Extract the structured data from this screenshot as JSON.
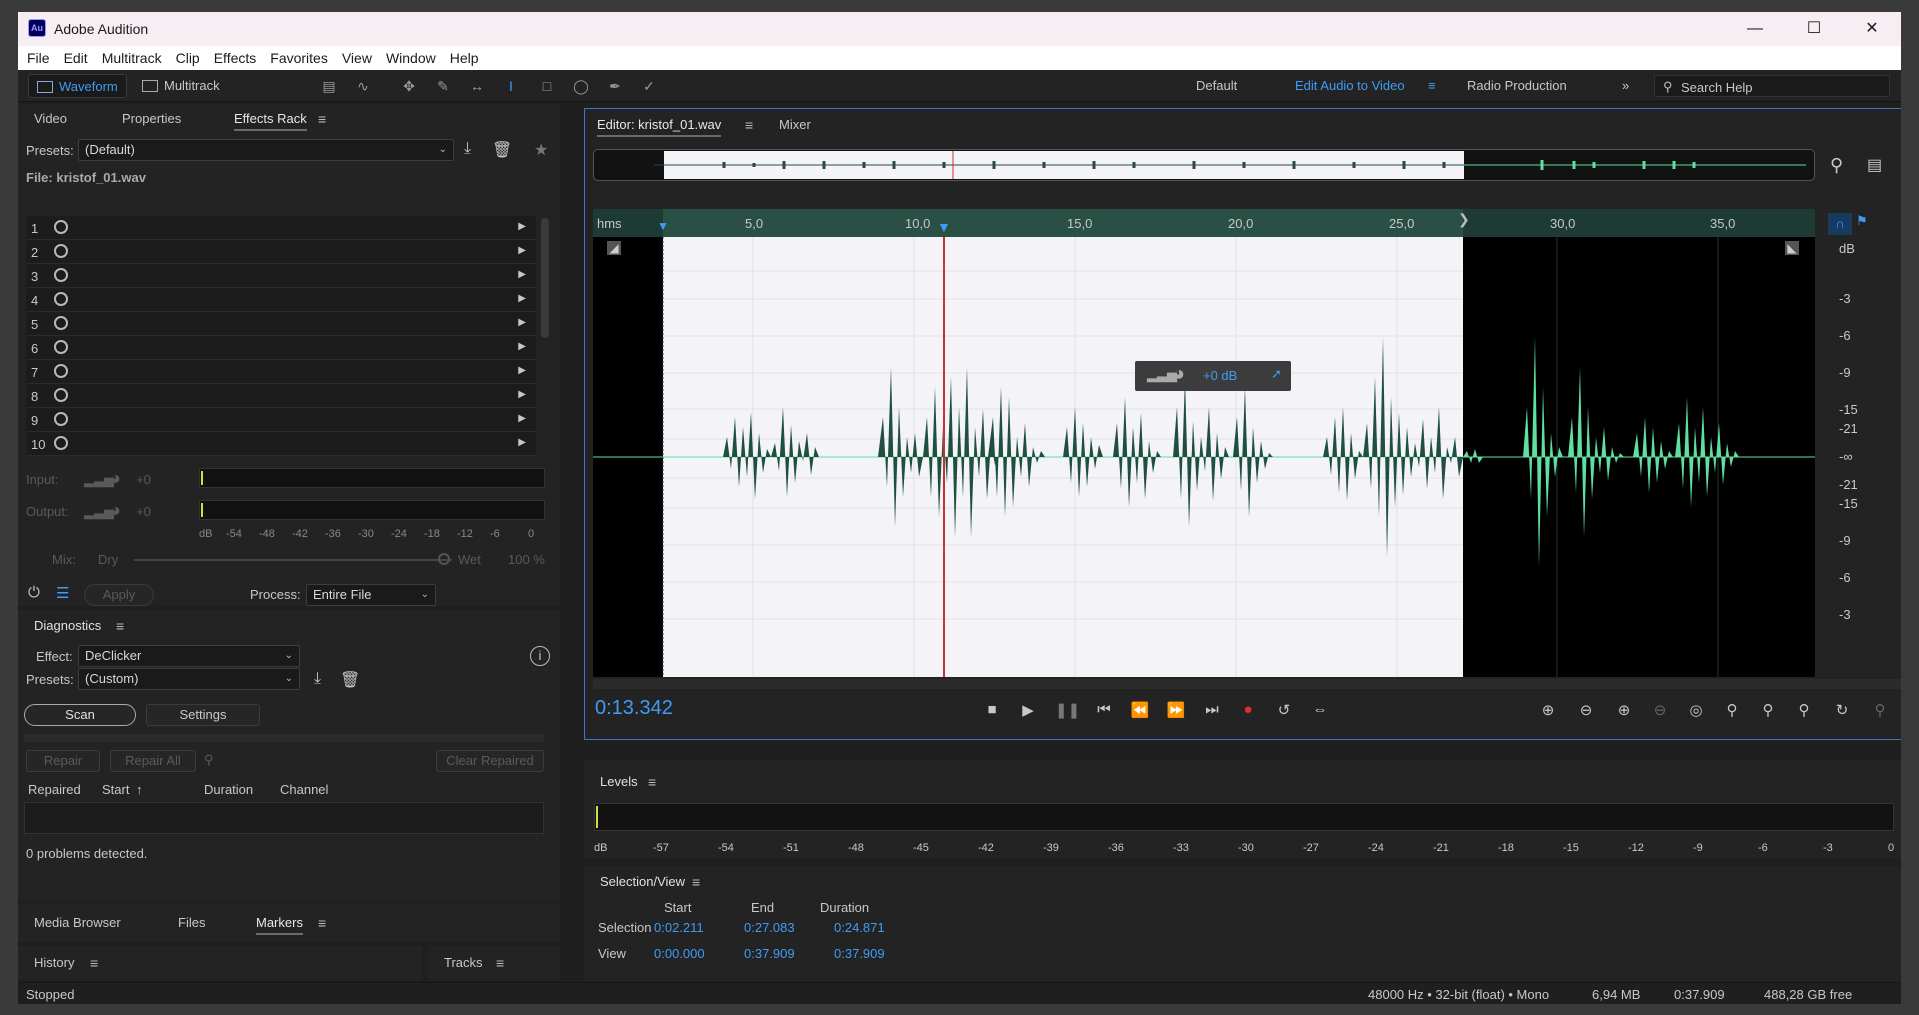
{
  "window": {
    "app_icon": "Au",
    "title": "Adobe Audition"
  },
  "menu": [
    "File",
    "Edit",
    "Multitrack",
    "Clip",
    "Effects",
    "Favorites",
    "View",
    "Window",
    "Help"
  ],
  "toolbar": {
    "waveform": "Waveform",
    "multitrack": "Multitrack",
    "workspaces": [
      "Default",
      "Edit Audio to Video",
      "Radio Production"
    ],
    "active_workspace": "Edit Audio to Video",
    "search_placeholder": "Search Help"
  },
  "left_panel": {
    "tabs": [
      "Video",
      "Properties",
      "Effects Rack"
    ],
    "active_tab": "Effects Rack",
    "presets_label": "Presets:",
    "presets_value": "(Default)",
    "file_label": "File: kristof_01.wav",
    "slots": [
      "1",
      "2",
      "3",
      "4",
      "5",
      "6",
      "7",
      "8",
      "9",
      "10"
    ],
    "input_label": "Input:",
    "input_value": "+0",
    "output_label": "Output:",
    "output_value": "+0",
    "meter_scale": [
      "dB",
      "-54",
      "-48",
      "-42",
      "-36",
      "-30",
      "-24",
      "-18",
      "-12",
      "-6",
      "0"
    ],
    "mix_label": "Mix:",
    "dry_label": "Dry",
    "wet_label": "Wet",
    "wet_value": "100 %",
    "apply": "Apply",
    "process_label": "Process:",
    "process_value": "Entire File"
  },
  "diagnostics": {
    "title": "Diagnostics",
    "effect_label": "Effect:",
    "effect_value": "DeClicker",
    "presets_label": "Presets:",
    "presets_value": "(Custom)",
    "scan": "Scan",
    "settings": "Settings",
    "repair": "Repair",
    "repair_all": "Repair All",
    "clear_repaired": "Clear Repaired",
    "columns": [
      "Repaired",
      "Start",
      "Duration",
      "Channel"
    ],
    "status": "0 problems detected."
  },
  "bottom_left_tabs": [
    "Media Browser",
    "Files",
    "Markers"
  ],
  "active_bottom_tab": "Markers",
  "history_title": "History",
  "tracks_title": "Tracks",
  "editor": {
    "tab": "Editor: kristof_01.wav",
    "mixer": "Mixer",
    "ruler_unit": "hms",
    "ruler_ticks": [
      "5,0",
      "10,0",
      "15,0",
      "20,0",
      "25,0",
      "30,0",
      "35,0"
    ],
    "db_ticks": [
      "dB",
      "-3",
      "-6",
      "-9",
      "-15",
      "-21",
      "-∞",
      "-21",
      "-15",
      "-9",
      "-6",
      "-3"
    ],
    "gain_hud": "+0 dB",
    "timecode": "0:13.342",
    "selection_fraction": [
      0.0583,
      0.7153
    ],
    "playhead_fraction": 0.3519
  },
  "levels": {
    "title": "Levels",
    "scale": [
      "dB",
      "-57",
      "-54",
      "-51",
      "-48",
      "-45",
      "-42",
      "-39",
      "-36",
      "-33",
      "-30",
      "-27",
      "-24",
      "-21",
      "-18",
      "-15",
      "-12",
      "-9",
      "-6",
      "-3",
      "0"
    ]
  },
  "selection_view": {
    "title": "Selection/View",
    "headers": [
      "Start",
      "End",
      "Duration"
    ],
    "rows": [
      {
        "label": "Selection",
        "start": "0:02.211",
        "end": "0:27.083",
        "duration": "0:24.871"
      },
      {
        "label": "View",
        "start": "0:00.000",
        "end": "0:37.909",
        "duration": "0:37.909"
      }
    ]
  },
  "status": {
    "state": "Stopped",
    "format": "48000 Hz • 32-bit (float) • Mono",
    "size": "6,94 MB",
    "duration": "0:37.909",
    "free": "488,28 GB free"
  },
  "colors": {
    "accent": "#3f9cf5",
    "wave_selected": "#1f4f3f",
    "wave_unselected": "#5fe0a0",
    "playhead": "#c8312c"
  }
}
